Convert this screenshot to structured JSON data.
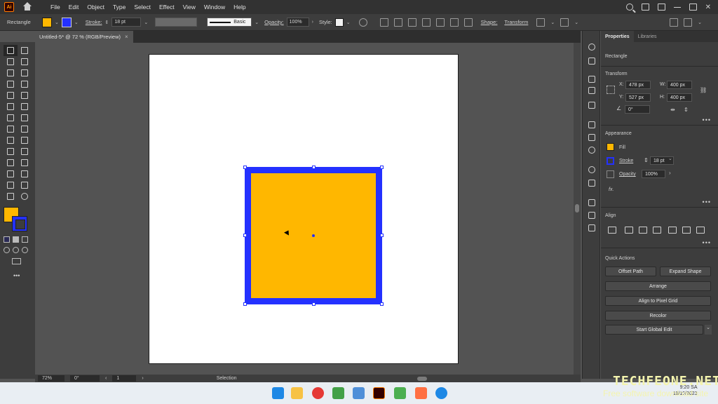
{
  "app": {
    "logo": "Ai"
  },
  "menu": [
    "File",
    "Edit",
    "Object",
    "Type",
    "Select",
    "Effect",
    "View",
    "Window",
    "Help"
  ],
  "control_bar": {
    "object_type": "Rectangle",
    "fill_color": "#ffb700",
    "stroke_color": "#2431ff",
    "stroke_label": "Stroke:",
    "stroke_value": "18 pt",
    "brush_label": "Basic",
    "opacity_label": "Opacity:",
    "opacity_value": "100%",
    "style_label": "Style:",
    "shape_label": "Shape:",
    "transform_label": "Transform"
  },
  "document_tab": {
    "title": "Untitled-5* @ 72 % (RGB/Preview)",
    "close": "×"
  },
  "status_bar": {
    "zoom": "72%",
    "rotation": "0°",
    "artboard": "1",
    "tool": "Selection"
  },
  "properties": {
    "tabs": [
      "Properties",
      "Libraries"
    ],
    "selection": "Rectangle",
    "transform": {
      "title": "Transform",
      "x_label": "X:",
      "x": "478 px",
      "y_label": "Y:",
      "y": "527 px",
      "w_label": "W:",
      "w": "400 px",
      "h_label": "H:",
      "h": "400 px",
      "angle": "0°"
    },
    "appearance": {
      "title": "Appearance",
      "fill_label": "Fill",
      "stroke_label": "Stroke",
      "stroke_value": "18 pt",
      "opacity_label": "Opacity",
      "opacity_value": "100%",
      "fx": "fx."
    },
    "align": {
      "title": "Align"
    },
    "quick_actions": {
      "title": "Quick Actions",
      "offset_path": "Offset Path",
      "expand_shape": "Expand Shape",
      "arrange": "Arrange",
      "align_pixel": "Align to Pixel Grid",
      "recolor": "Recolor",
      "start_global_edit": "Start Global Edit"
    },
    "more": "•••"
  },
  "watermark": {
    "title": "TECHFEONE.NET",
    "subtitle": "Free software download site"
  },
  "clock": {
    "time": "9:20 SA",
    "date": "11/10/2023"
  }
}
